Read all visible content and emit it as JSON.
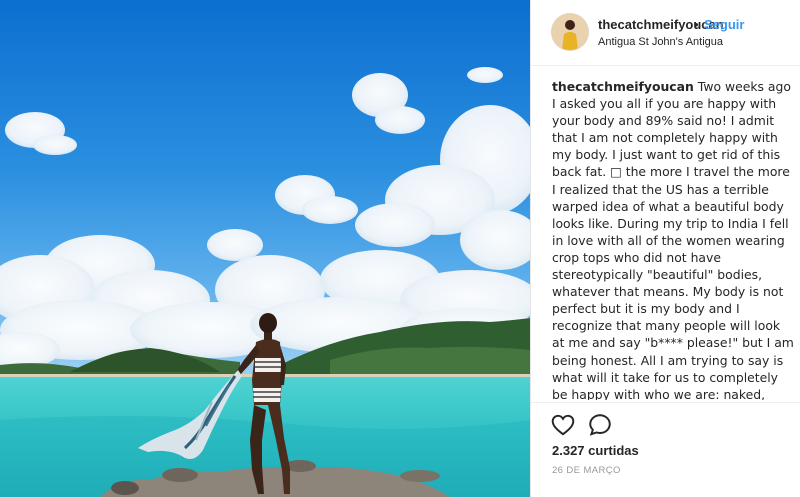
{
  "post": {
    "username": "thecatchmeifyoucan",
    "separator": "•",
    "follow_label": "Seguir",
    "location": "Antigua St John's Antigua",
    "caption_user": "thecatchmeifyoucan",
    "caption_text": "Two weeks ago I asked you all if you are happy with your body and 89% said no! I admit that I am not completely happy with my body. I just want to get rid of this back fat. □ the more I travel the more I realized that the US has a terrible warped idea of what a beautiful body looks like. During my trip to India I fell in love with all of the women wearing crop tops who did not have stereotypically \"beautiful\" bodies, whatever that means. My body is not perfect but it is my body and I recognize that many people will look at me and say \"b**** please!\" but I am being honest. All I am trying to say is what will it take for us to completely be happy with who we are: naked, sans makeup, sans any accoutrement, exactly as the universe, god, allah,",
    "likes": "2.327 curtidas",
    "date": "26 de março"
  },
  "icons": {
    "like": "heart-outline-icon",
    "comment": "speech-bubble-icon"
  },
  "colors": {
    "link": "#3897f0",
    "text": "#262626",
    "muted": "#999999",
    "sky": "#2a86d8",
    "sea": "#33c6c8"
  }
}
